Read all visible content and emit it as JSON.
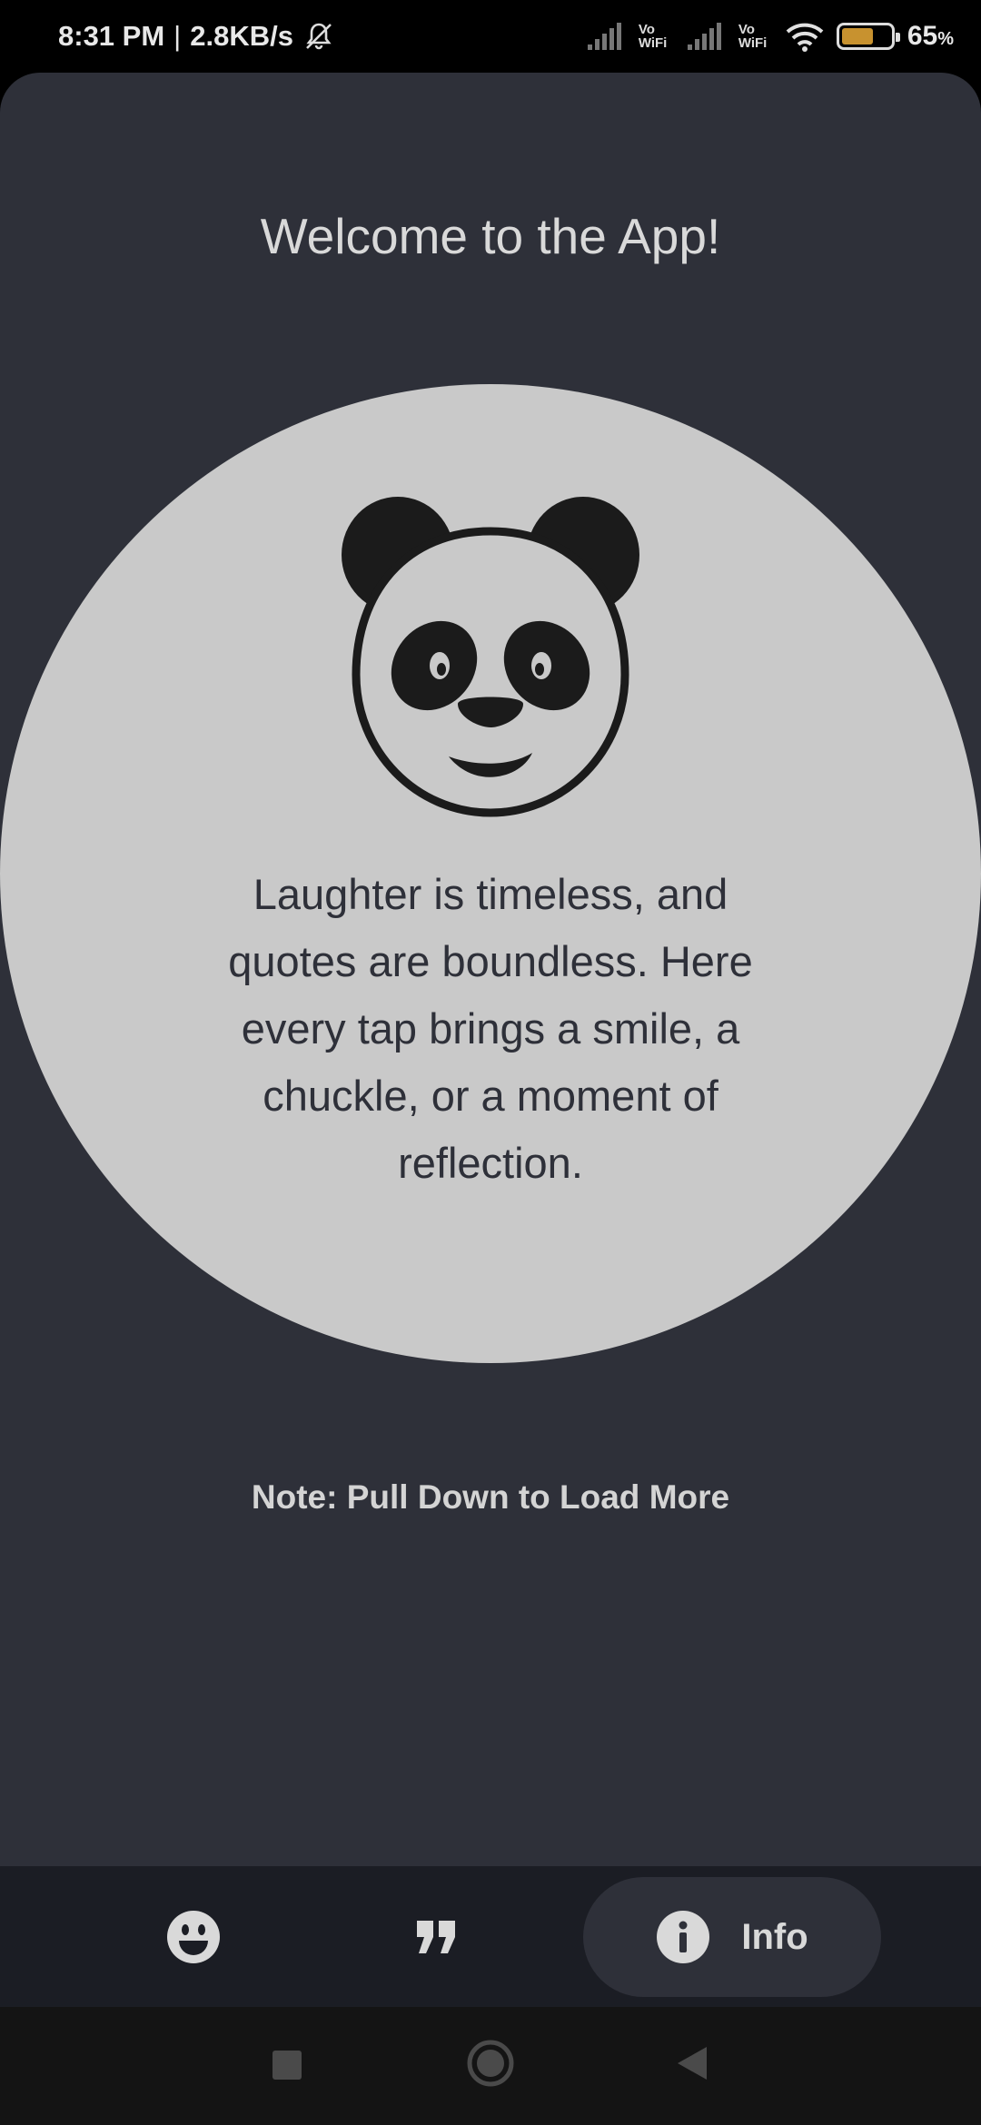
{
  "status_bar": {
    "time": "8:31 PM",
    "speed": "2.8KB/s",
    "battery_percent": "65",
    "battery_unit": "%",
    "battery_level": 0.65,
    "network_1": "Vo WiFi",
    "network_2": "Vo WiFi",
    "icons": [
      "mute-icon",
      "signal-icon",
      "wifi-icon",
      "battery-icon"
    ]
  },
  "main": {
    "title": "Welcome to the App!",
    "quote": "Laughter is timeless, and quotes are boundless. Here every tap brings a smile, a chuckle, or a moment of reflection.",
    "note": "Note: Pull Down to Load More",
    "mascot": "panda-icon"
  },
  "bottom_nav": {
    "items": [
      {
        "icon": "smiley-icon",
        "label": ""
      },
      {
        "icon": "quote-icon",
        "label": ""
      },
      {
        "icon": "info-icon",
        "label": "Info",
        "active": true
      }
    ]
  },
  "system_nav": [
    "recents-icon",
    "home-icon",
    "back-icon"
  ],
  "colors": {
    "background": "#2e3039",
    "circle": "#c9c9c9",
    "nav_bar": "#1b1d24",
    "active_pill": "#2e3039",
    "text_light": "#d9d9d9",
    "battery_fill": "#c8922f"
  }
}
